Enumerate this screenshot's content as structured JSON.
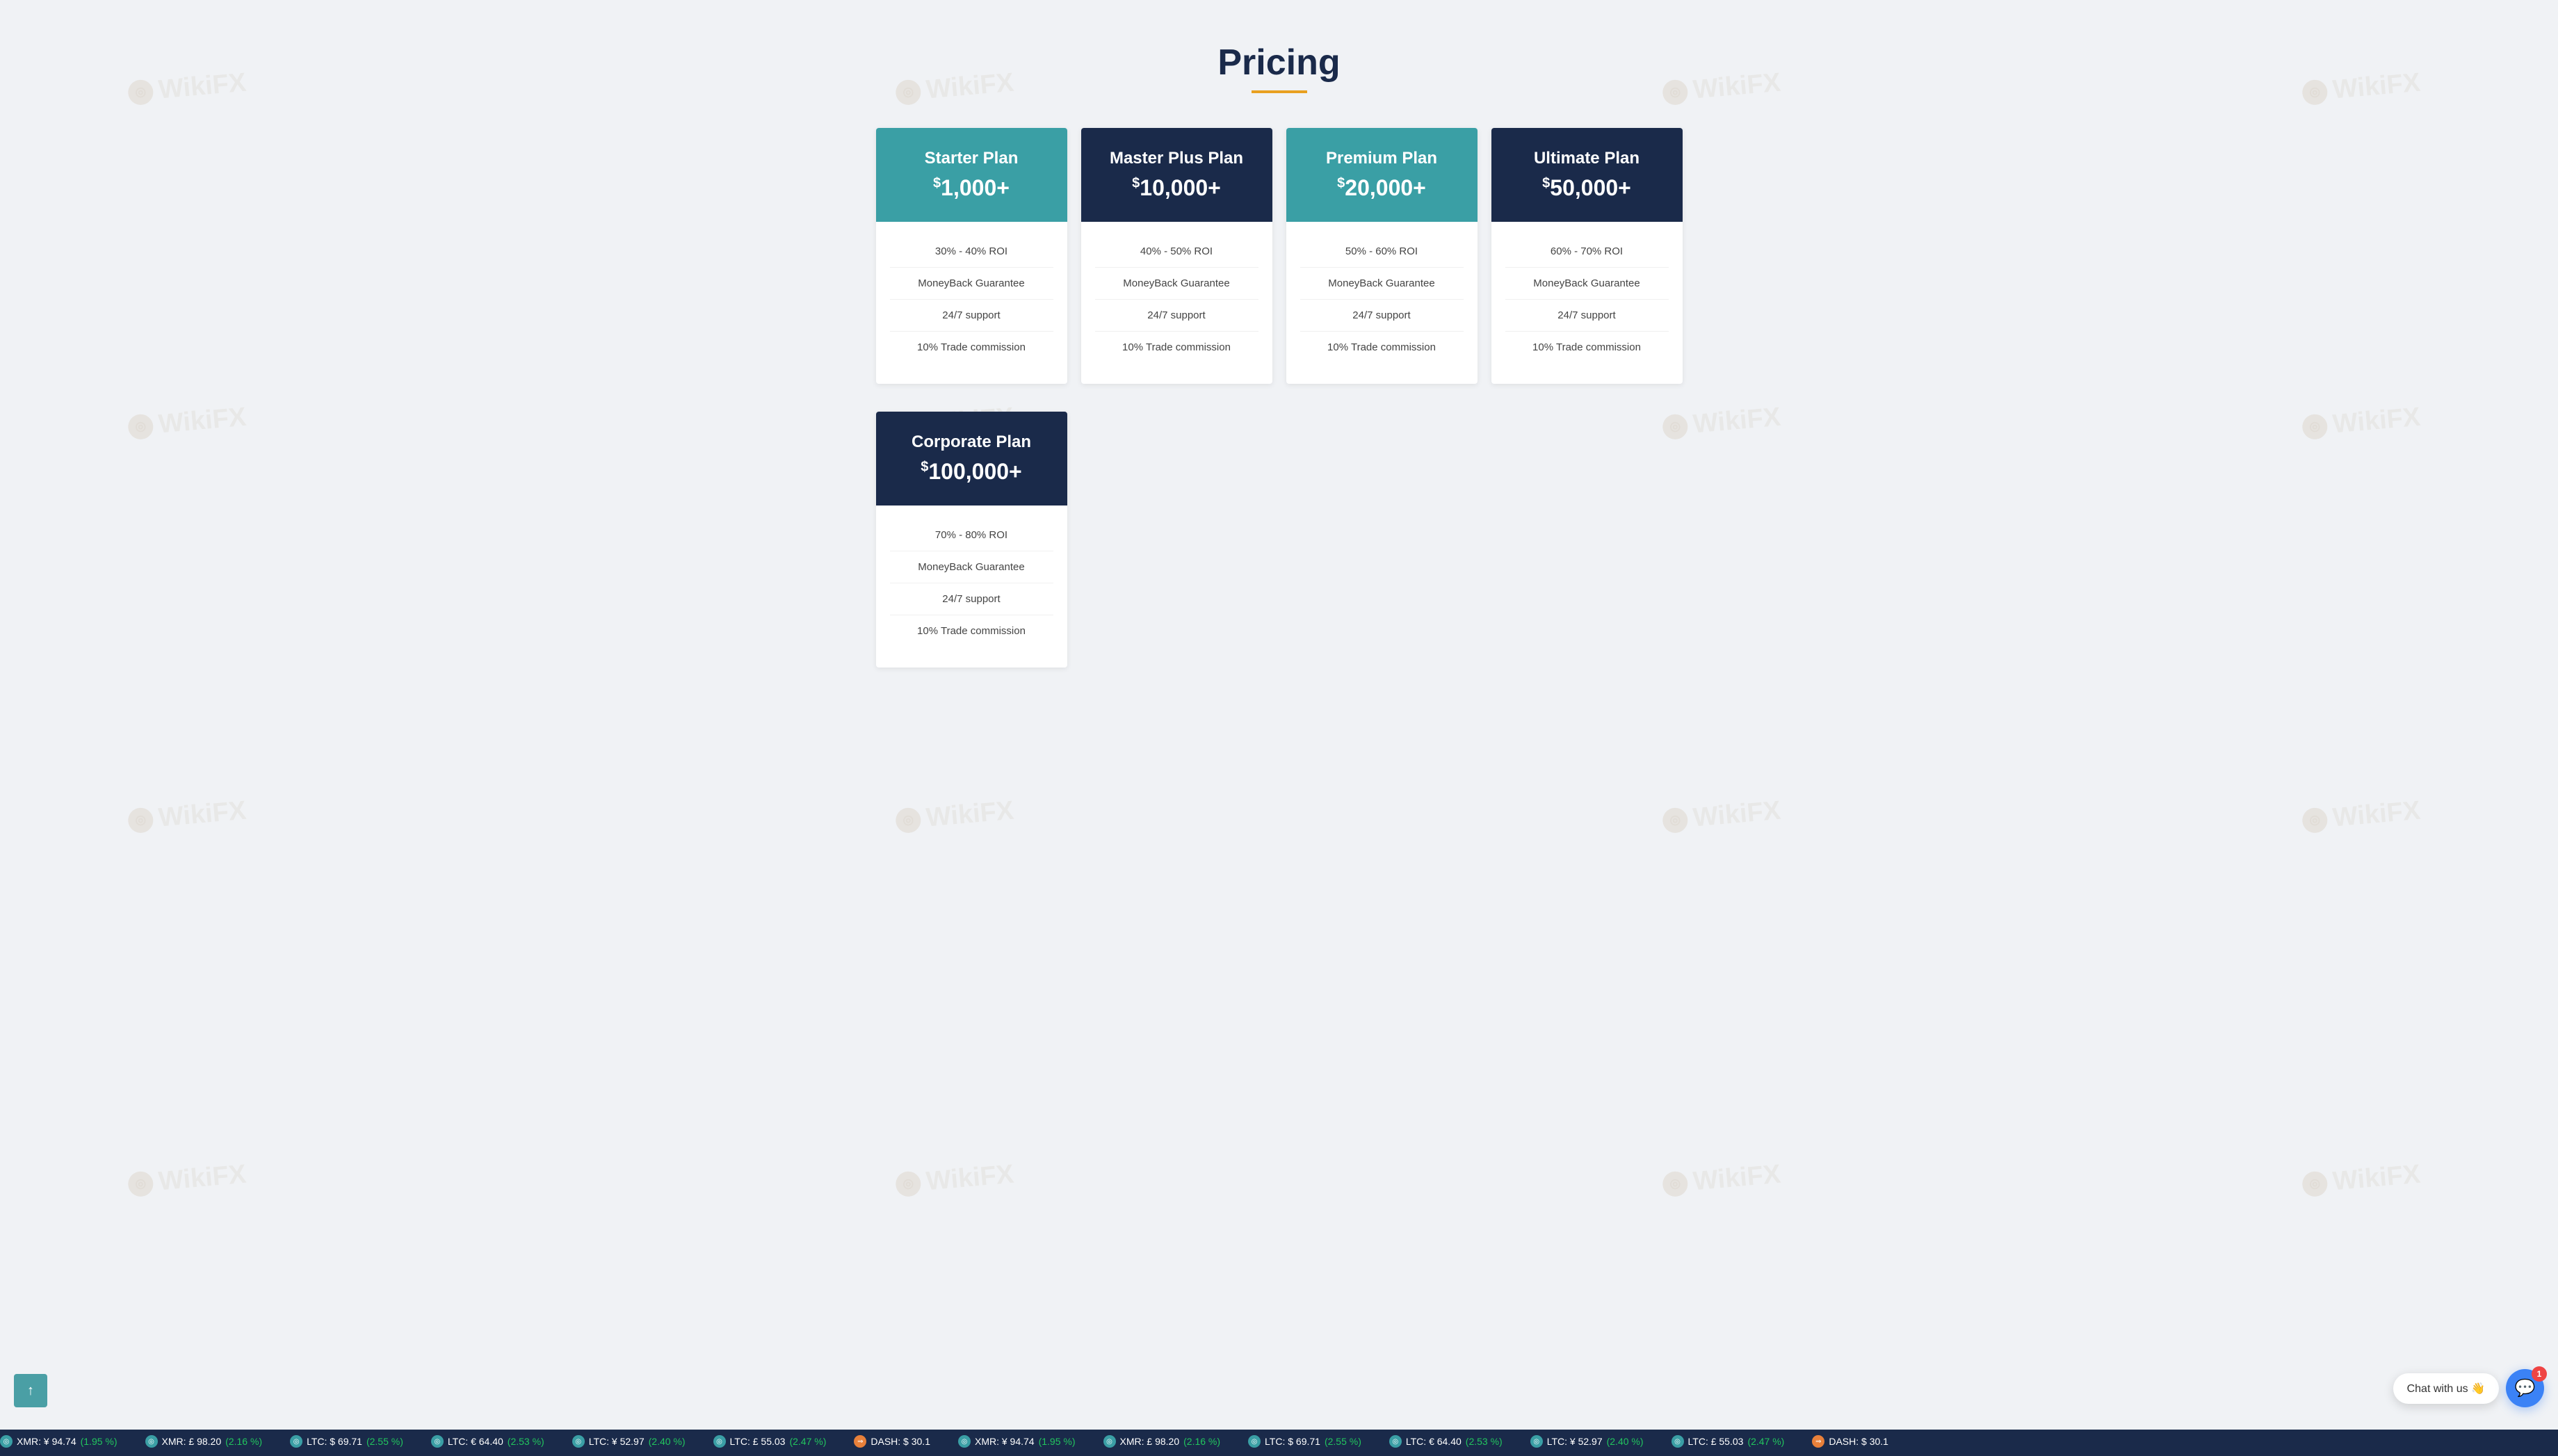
{
  "page": {
    "title": "Pricing",
    "title_underline_color": "#e8a020",
    "background_color": "#f0f2f5"
  },
  "plans": [
    {
      "id": "starter",
      "name": "Starter Plan",
      "price": "1,000+",
      "header_style": "teal",
      "roi": "30% - 40% ROI",
      "moneyback": "MoneyBack Guarantee",
      "support": "24/7 support",
      "commission": "10% Trade commission"
    },
    {
      "id": "master-plus",
      "name": "Master Plus Plan",
      "price": "10,000+",
      "header_style": "dark-navy",
      "roi": "40% - 50% ROI",
      "moneyback": "MoneyBack Guarantee",
      "support": "24/7 support",
      "commission": "10% Trade commission"
    },
    {
      "id": "premium",
      "name": "Premium Plan",
      "price": "20,000+",
      "header_style": "teal",
      "roi": "50% - 60% ROI",
      "moneyback": "MoneyBack Guarantee",
      "support": "24/7 support",
      "commission": "10% Trade commission"
    },
    {
      "id": "ultimate",
      "name": "Ultimate Plan",
      "price": "50,000+",
      "header_style": "dark-navy",
      "roi": "60% - 70% ROI",
      "moneyback": "MoneyBack Guarantee",
      "support": "24/7 support",
      "commission": "10% Trade commission"
    },
    {
      "id": "corporate",
      "name": "Corporate Plan",
      "price": "100,000+",
      "header_style": "dark-navy",
      "roi": "70% - 80% ROI",
      "moneyback": "MoneyBack Guarantee",
      "support": "24/7 support",
      "commission": "10% Trade commission"
    }
  ],
  "chat_widget": {
    "label": "Chat with us 👋",
    "badge": "1"
  },
  "ticker": {
    "items": [
      {
        "icon": "◎",
        "label": "XMR: ¥ 94.74",
        "change": "(1.95 %)",
        "direction": "up"
      },
      {
        "icon": "◎",
        "label": "XMR: £ 98.20",
        "change": "(2.16 %)",
        "direction": "up"
      },
      {
        "icon": "◎",
        "label": "LTC: $ 69.71",
        "change": "(2.55 %)",
        "direction": "up"
      },
      {
        "icon": "◎",
        "label": "LTC: € 64.40",
        "change": "(2.53 %)",
        "direction": "up"
      },
      {
        "icon": "◎",
        "label": "LTC: ¥ 52.97",
        "change": "(2.40 %)",
        "direction": "up"
      },
      {
        "icon": "◎",
        "label": "LTC: £ 55.03",
        "change": "(2.47 %)",
        "direction": "up"
      },
      {
        "icon": "◉",
        "label": "DASH: $ 30.1",
        "change": "",
        "direction": "neutral"
      }
    ]
  },
  "scroll_top": {
    "label": "↑"
  },
  "watermark": {
    "text": "WikiFX"
  }
}
